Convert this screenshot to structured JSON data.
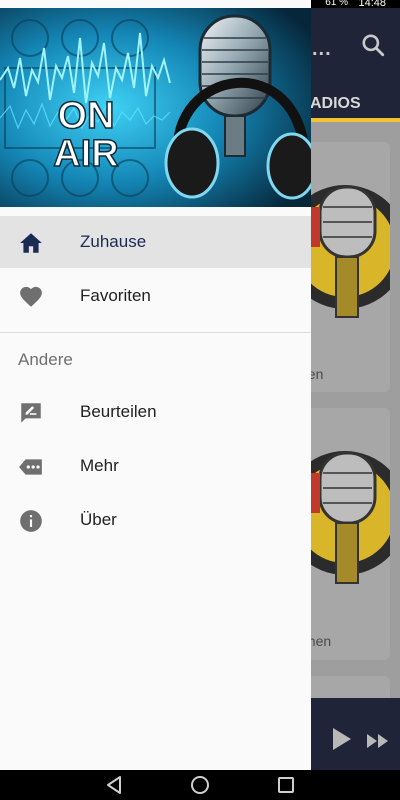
{
  "status_bar": {
    "battery": "61 %",
    "time": "14:48"
  },
  "app_behind": {
    "title_visible": "...",
    "tab_visible": "ADIOS",
    "card_subtitles": [
      "nen",
      "onen"
    ]
  },
  "header": {
    "image_text_line1": "ON",
    "image_text_line2": "AIR"
  },
  "menu": {
    "items": [
      {
        "label": "Zuhause",
        "icon": "home-icon",
        "active": true
      },
      {
        "label": "Favoriten",
        "icon": "heart-icon",
        "active": false
      }
    ],
    "section_title": "Andere",
    "other_items": [
      {
        "label": "Beurteilen",
        "icon": "rate-review-icon"
      },
      {
        "label": "Mehr",
        "icon": "more-tag-icon"
      },
      {
        "label": "Über",
        "icon": "info-icon"
      }
    ]
  },
  "colors": {
    "accent": "#1b2a55",
    "toolbar": "#1f2438",
    "tab_indicator": "#f2c230",
    "header_glow": "#2ab7e6"
  }
}
